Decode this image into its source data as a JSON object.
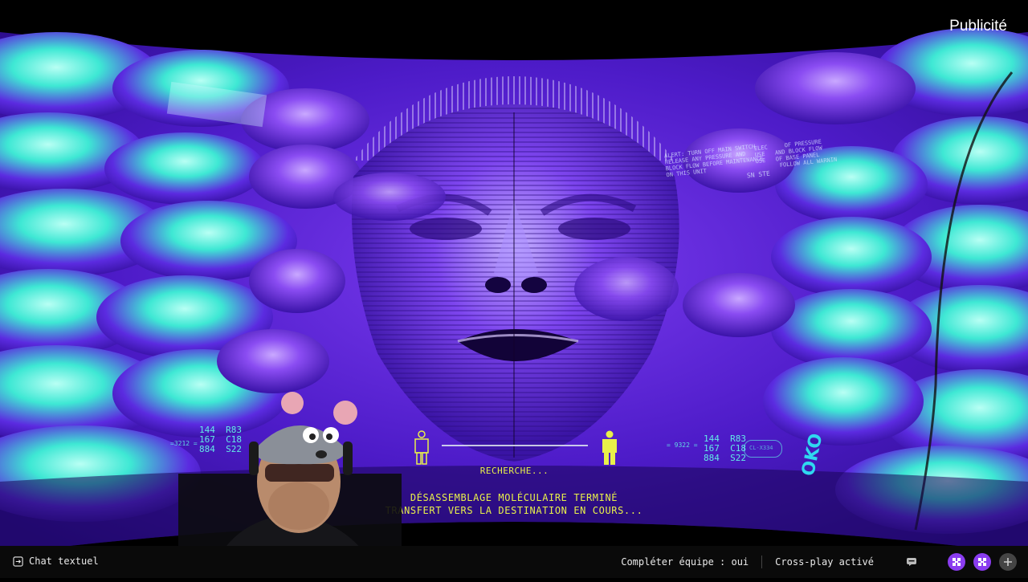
{
  "overlay": {
    "ad_label": "Publicité"
  },
  "hud": {
    "search_text": "RECHERCHE...",
    "status_line_1": "DÉSASSEMBLAGE MOLÉCULAIRE TERMINÉ",
    "status_line_2": "TRANSFERT VERS LA DESTINATION EN COURS...",
    "code_left": "144  R83\n167  C18\n884  S22",
    "code_right": "144  R83\n167  C18\n884  S22",
    "code_left_small": "=3212 =",
    "code_right_small": "= 9322 =",
    "badge_code": "CL-X334",
    "logo_text": "OKO",
    "wall_warning_1": "ALERT: TURN OFF MAIN SWITCH\nRELEASE ANY PRESSURE AND\nBLOCK FLOW BEFORE MAINTENANCE\nON THIS UNIT",
    "wall_warning_2": "ELEC     OF PRESSURE\nUSE   AND BLOCK FLOW\nUSE   OF BASE PANEL\n       FOLLOW ALL WARNIN",
    "wall_label": "SN STE"
  },
  "bottom_bar": {
    "chat_label": "Chat textuel",
    "team_fill": "Compléter équipe : oui",
    "crossplay": "Cross-play activé"
  },
  "colors": {
    "hud_yellow": "#e8f04a",
    "hud_cyan": "#66ffea",
    "scene_purple": "#5a22d8",
    "scene_teal": "#3ee8d4",
    "bar_bg": "#0a0a0a"
  }
}
